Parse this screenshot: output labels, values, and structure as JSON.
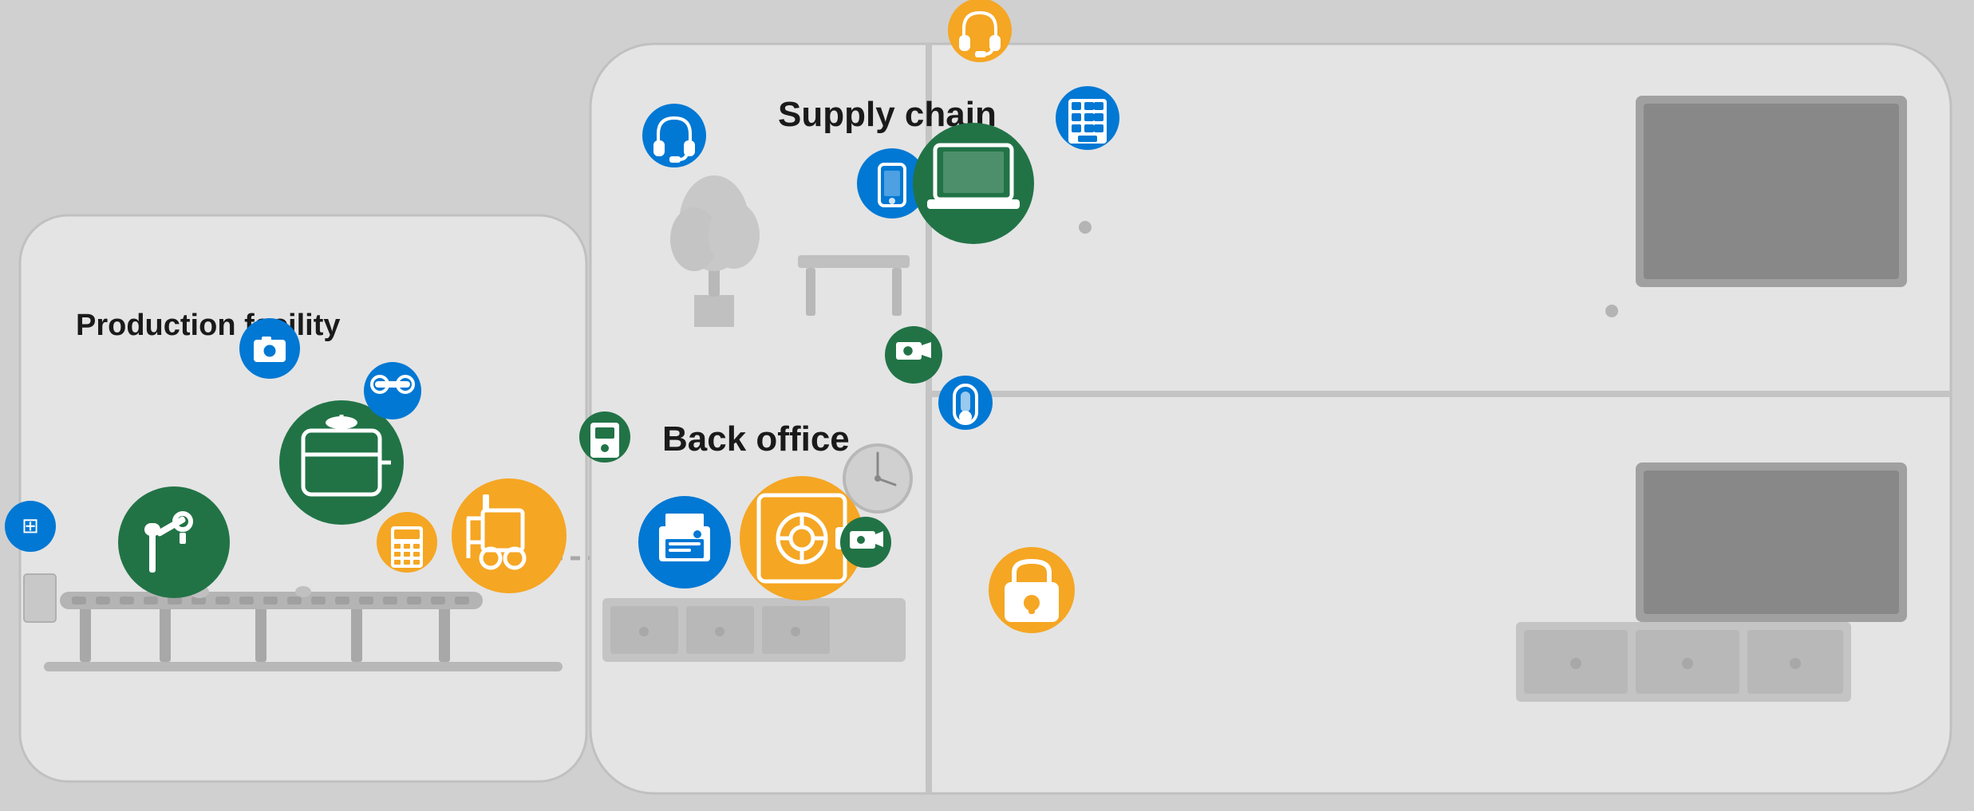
{
  "labels": {
    "production_facility": "Production facility",
    "back_office": "Back office",
    "supply_chain": "Supply chain"
  },
  "colors": {
    "green": "#217346",
    "blue": "#0078d4",
    "yellow": "#f5a623",
    "background": "#d4d4d4",
    "building": "#e6e6e6"
  },
  "icons": {
    "robot_arm": "robot-arm-icon",
    "tank": "tank-icon",
    "forklift": "forklift-icon",
    "camera1": "camera-icon",
    "camera2": "camera-icon",
    "laptop": "laptop-icon",
    "phone": "phone-icon",
    "headset1": "headset-icon",
    "headset2": "headset-icon",
    "safe": "safe-icon",
    "printer": "printer-icon",
    "keypad": "keypad-icon",
    "controller": "controller-icon",
    "lock": "lock-icon",
    "thermostat": "thermostat-icon",
    "door_sensor": "door-sensor-icon",
    "calculator": "calculator-icon",
    "conveyor_icon": "conveyor-icon"
  }
}
